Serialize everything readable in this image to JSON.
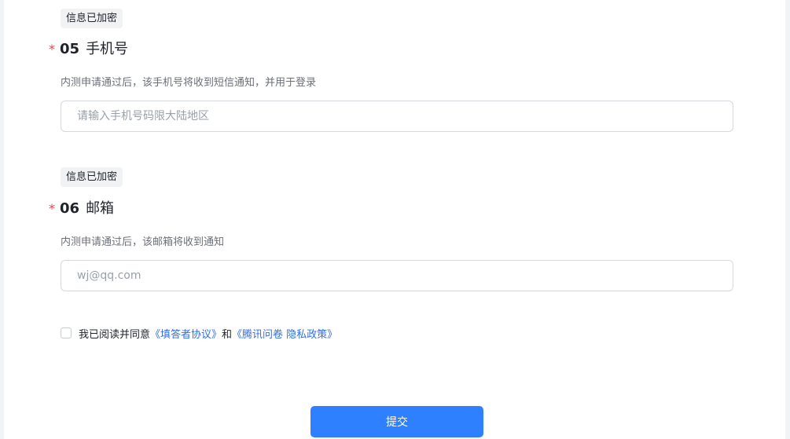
{
  "questions": [
    {
      "badge": "信息已加密",
      "required_mark": "*",
      "number": "05",
      "title": "手机号",
      "description": "内测申请通过后，该手机号将收到短信通知，并用于登录",
      "input_value": "",
      "placeholder": "请输入手机号码限大陆地区"
    },
    {
      "badge": "信息已加密",
      "required_mark": "*",
      "number": "06",
      "title": "邮箱",
      "description": "内测申请通过后，该邮箱将收到通知",
      "input_value": "",
      "placeholder": "wj@qq.com"
    }
  ],
  "agreement": {
    "checked": false,
    "prefix": "我已阅读并同意",
    "link1": "《填答者协议》",
    "joiner": "和",
    "link2": "《腾讯问卷 隐私政策》"
  },
  "submit_label": "提交",
  "colors": {
    "primary": "#2f80ff",
    "link": "#2f6fe4",
    "required": "#e54545",
    "badge_bg": "#f1f2f4"
  }
}
